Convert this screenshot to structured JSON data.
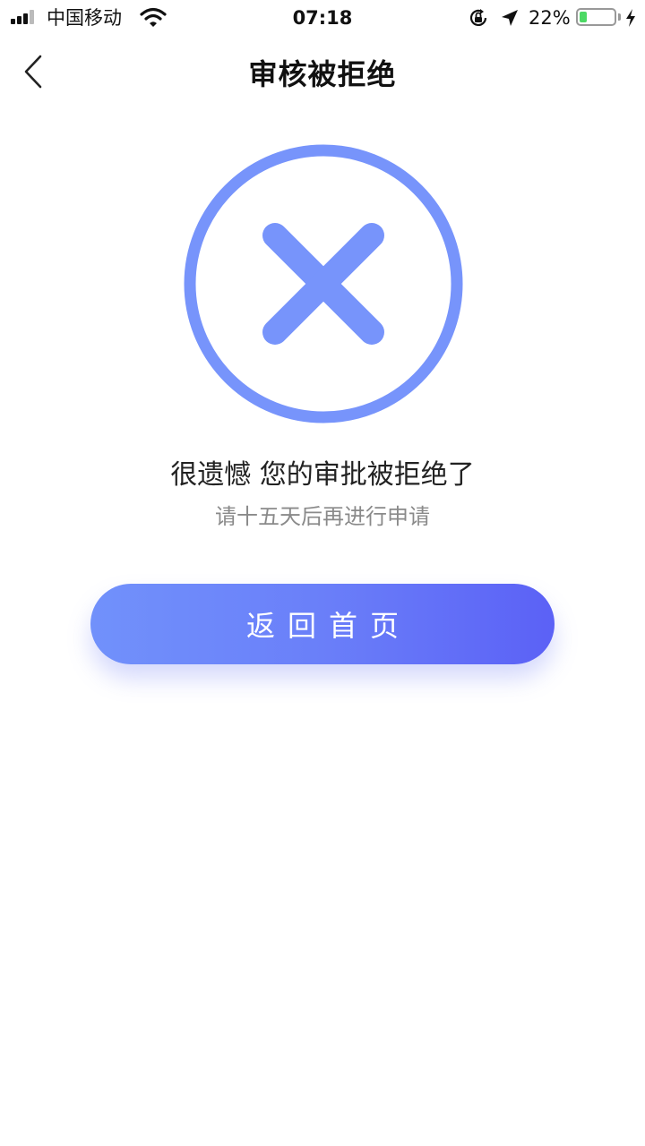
{
  "status_bar": {
    "carrier": "中国移动",
    "time": "07:18",
    "battery_percent": "22%",
    "battery_level": 0.22,
    "icons": [
      "signal-icon",
      "wifi-icon",
      "orientation-lock-icon",
      "location-icon",
      "battery-icon",
      "charging-icon"
    ]
  },
  "nav": {
    "title": "审核被拒绝",
    "back_icon": "chevron-left-icon"
  },
  "result": {
    "icon": "reject-circle-x-icon",
    "title": "很遗憾 您的审批被拒绝了",
    "subtitle": "请十五天后再进行申请"
  },
  "actions": {
    "home_label": "返回首页"
  },
  "colors": {
    "accent": "#7191fb",
    "accent_end": "#5b61f6",
    "icon_blue": "#7794fb",
    "subtitle_gray": "#8a8a8a"
  }
}
